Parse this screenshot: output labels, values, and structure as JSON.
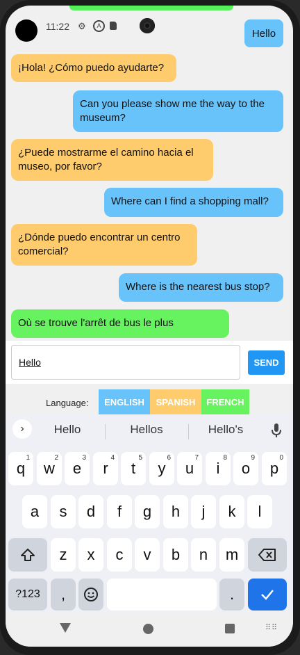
{
  "status": {
    "time": "11:22",
    "icons": [
      "gear-icon",
      "a-circle-icon",
      "sd-card-icon"
    ],
    "right_icons": [
      "wifi-icon",
      "signal-icon",
      "battery-icon"
    ]
  },
  "top_chip": {
    "text": "Hello"
  },
  "messages": [
    {
      "role": "bot",
      "text": "¡Hola! ¿Cómo puedo ayudarte?"
    },
    {
      "role": "user",
      "text": "Can you please show me the way to the museum?"
    },
    {
      "role": "bot",
      "text": "¿Puede mostrarme el camino hacia el museo, por favor?"
    },
    {
      "role": "user",
      "text": "Where can I find a shopping mall?"
    },
    {
      "role": "bot",
      "text": "¿Dónde puedo encontrar un centro comercial?"
    },
    {
      "role": "user",
      "text": "Where is the nearest bus stop?"
    },
    {
      "role": "bot",
      "text": "Où se trouve l'arrêt de bus le plus"
    }
  ],
  "composer": {
    "value": "Hello",
    "send_label": "SEND"
  },
  "language": {
    "label": "Language:",
    "options": [
      {
        "label": "ENGLISH",
        "color": "#67c3fa"
      },
      {
        "label": "SPANISH",
        "color": "#ffcc6d"
      },
      {
        "label": "FRENCH",
        "color": "#67f25f"
      }
    ]
  },
  "keyboard": {
    "suggestions": [
      "Hello",
      "Hellos",
      "Hello's"
    ],
    "row1": [
      {
        "k": "q",
        "n": "1"
      },
      {
        "k": "w",
        "n": "2"
      },
      {
        "k": "e",
        "n": "3"
      },
      {
        "k": "r",
        "n": "4"
      },
      {
        "k": "t",
        "n": "5"
      },
      {
        "k": "y",
        "n": "6"
      },
      {
        "k": "u",
        "n": "7"
      },
      {
        "k": "i",
        "n": "8"
      },
      {
        "k": "o",
        "n": "9"
      },
      {
        "k": "p",
        "n": "0"
      }
    ],
    "row2": [
      "a",
      "s",
      "d",
      "f",
      "g",
      "h",
      "j",
      "k",
      "l"
    ],
    "row3": [
      "z",
      "x",
      "c",
      "v",
      "b",
      "n",
      "m"
    ],
    "symbols_label": "?123",
    "comma": ",",
    "period": "."
  },
  "colors": {
    "user_bubble": "#67c3fa",
    "bot_bubble": "#ffcc6d",
    "french_bubble": "#67f25f",
    "send": "#2196f3",
    "enter": "#1e74e8"
  }
}
